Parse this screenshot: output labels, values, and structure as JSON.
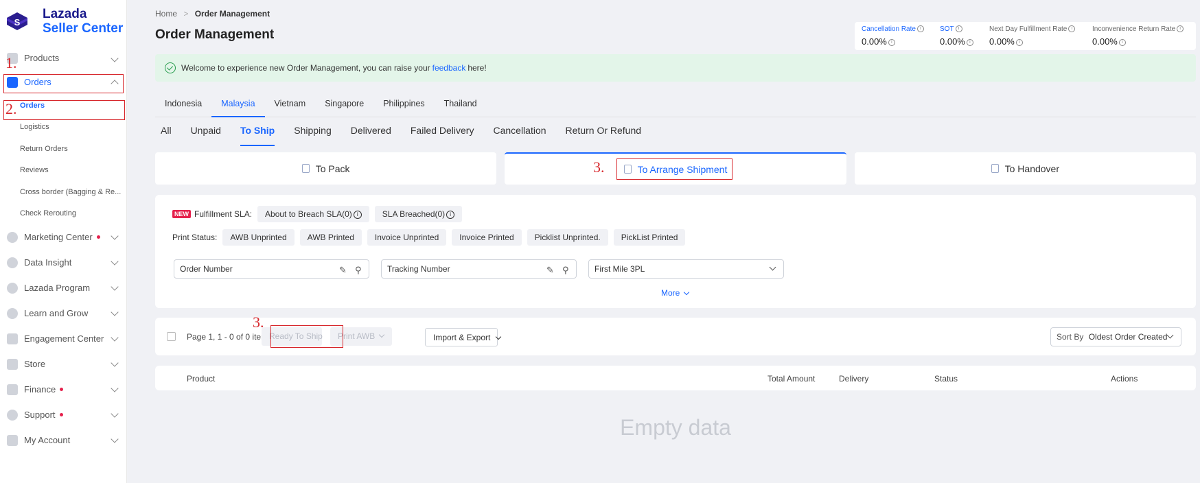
{
  "brand": {
    "line1": "Lazada",
    "line2": "Seller Center",
    "mark": "S"
  },
  "sidebar": {
    "items": [
      {
        "label": "Products",
        "icon": "box-icon"
      },
      {
        "label": "Orders",
        "icon": "orders-icon"
      },
      {
        "label": "Marketing Center",
        "icon": "marketing-icon"
      },
      {
        "label": "Data Insight",
        "icon": "chart-icon"
      },
      {
        "label": "Lazada Program",
        "icon": "program-icon"
      },
      {
        "label": "Learn and Grow",
        "icon": "learn-icon"
      },
      {
        "label": "Engagement Center",
        "icon": "engagement-icon"
      },
      {
        "label": "Store",
        "icon": "store-icon"
      },
      {
        "label": "Finance",
        "icon": "wallet-icon"
      },
      {
        "label": "Support",
        "icon": "support-icon"
      },
      {
        "label": "My Account",
        "icon": "account-icon"
      }
    ],
    "sub_items": [
      "Orders",
      "Logistics",
      "Return Orders",
      "Reviews",
      "Cross border (Bagging & Re...",
      "Check Rerouting"
    ]
  },
  "annotations": {
    "step1": "1.",
    "step2": "2.",
    "step3": "3."
  },
  "breadcrumb": {
    "home": "Home",
    "sep": ">",
    "current": "Order Management"
  },
  "page_title": "Order Management",
  "metrics": [
    {
      "label": "Cancellation Rate",
      "value": "0.00%"
    },
    {
      "label": "SOT",
      "value": "0.00%"
    },
    {
      "label": "Next Day Fulfillment Rate",
      "value": "0.00%"
    },
    {
      "label": "Inconvenience Return Rate",
      "value": "0.00%"
    }
  ],
  "banner": {
    "before": "Welcome to experience new Order Management, you can raise your",
    "link": "feedback",
    "after": "here!"
  },
  "country_tabs": [
    "Indonesia",
    "Malaysia",
    "Vietnam",
    "Singapore",
    "Philippines",
    "Thailand"
  ],
  "status_tabs": [
    "All",
    "Unpaid",
    "To Ship",
    "Shipping",
    "Delivered",
    "Failed Delivery",
    "Cancellation",
    "Return Or Refund"
  ],
  "sub_tabs": [
    "To Pack",
    "To Arrange Shipment",
    "To Handover"
  ],
  "filters": {
    "new_badge": "NEW",
    "sla_label": "Fulfillment SLA:",
    "sla_chips": [
      "About to Breach SLA(0)",
      "SLA Breached(0)"
    ],
    "print_label": "Print Status:",
    "print_chips": [
      "AWB Unprinted",
      "AWB Printed",
      "Invoice Unprinted",
      "Invoice Printed",
      "Picklist Unprinted.",
      "PickList Printed"
    ],
    "order_number": "Order Number",
    "tracking_number": "Tracking Number",
    "first_mile": "First Mile 3PL",
    "more": "More"
  },
  "toolbar": {
    "page_info": "Page 1, 1 - 0 of 0 items",
    "ready_to_ship": "Ready To Ship",
    "print_awb": "Print AWB",
    "import_export": "Import & Export",
    "sort_label": "Sort By",
    "sort_value": "Oldest Order Created"
  },
  "table": {
    "columns": [
      "Product",
      "Total Amount",
      "Delivery",
      "Status",
      "Actions"
    ],
    "empty": "Empty data"
  },
  "colors": {
    "accent": "#1a66ff",
    "annotation": "#d7262b",
    "badge": "#e5214c",
    "banner_bg": "#e3f5e9"
  }
}
